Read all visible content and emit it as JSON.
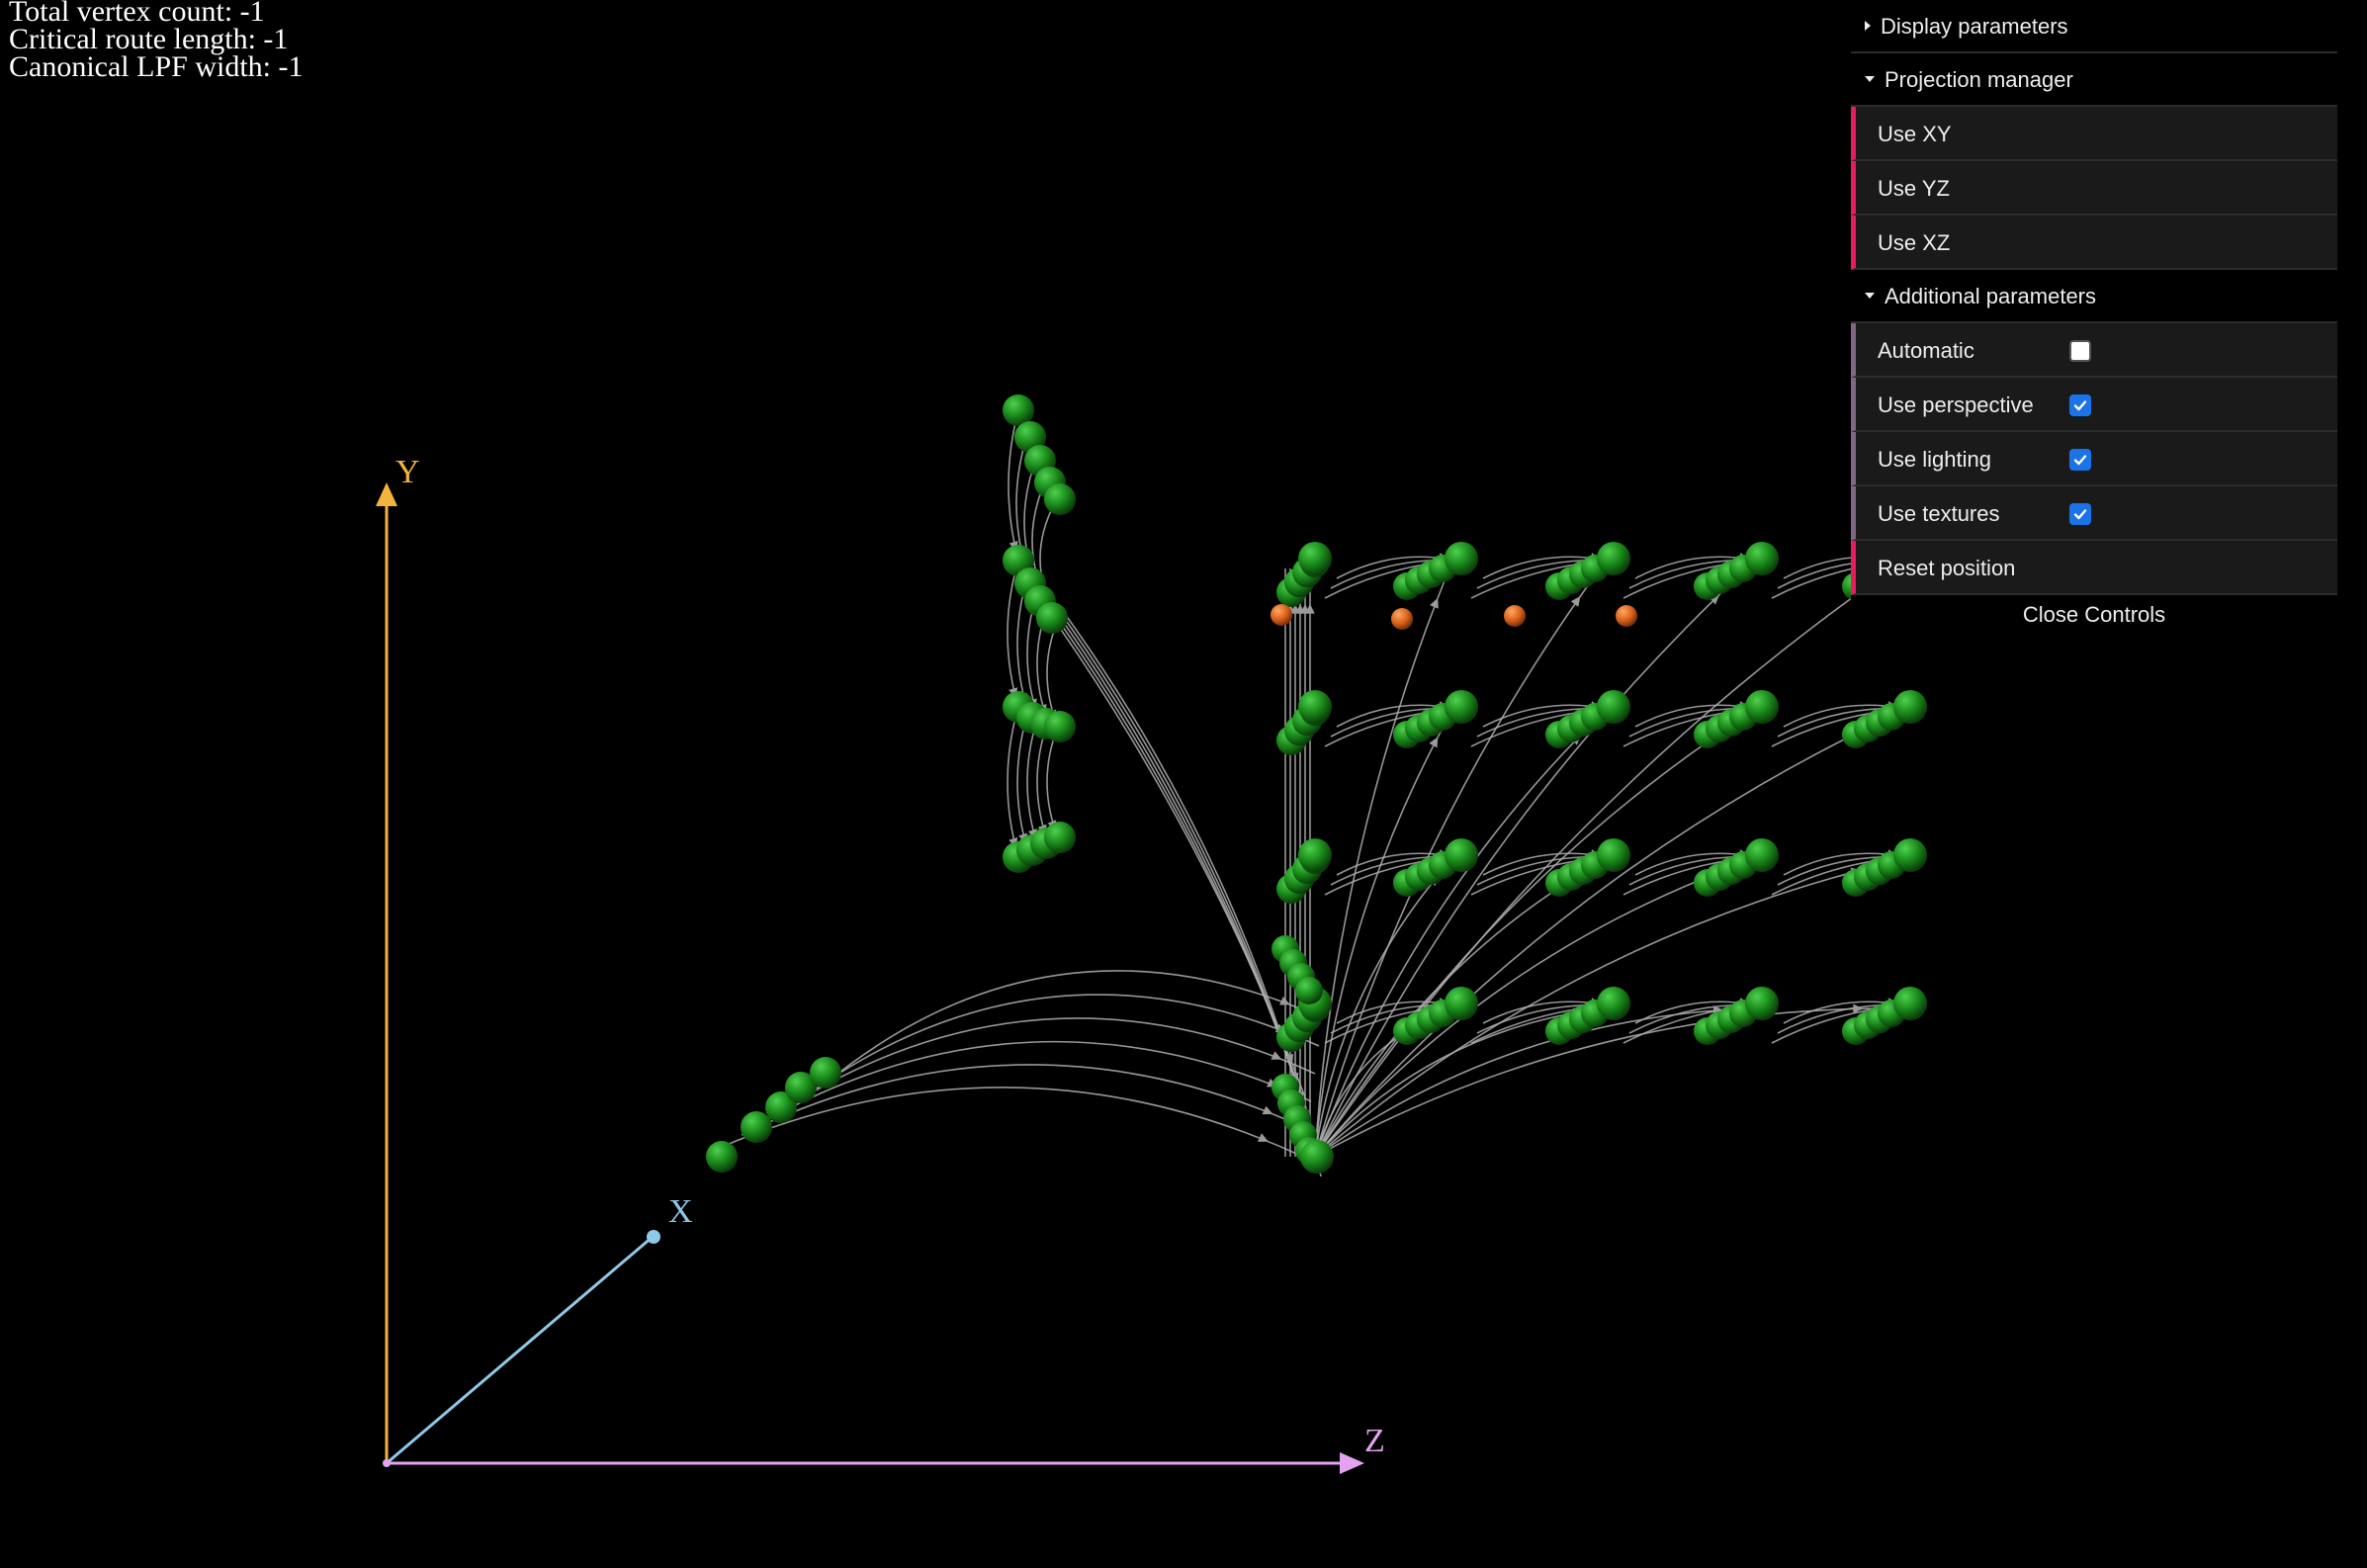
{
  "stats": {
    "vertex_count": "Total vertex count: -1",
    "route_length": "Critical route length: -1",
    "lpf_width": "Canonical LPF width: -1"
  },
  "gui": {
    "display_folder": "Display parameters",
    "projection_folder": "Projection manager",
    "use_xy": "Use XY",
    "use_yz": "Use YZ",
    "use_xz": "Use XZ",
    "additional_folder": "Additional parameters",
    "automatic": {
      "label": "Automatic",
      "checked": false
    },
    "perspective": {
      "label": "Use perspective",
      "checked": true
    },
    "lighting": {
      "label": "Use lighting",
      "checked": true
    },
    "textures": {
      "label": "Use textures",
      "checked": true
    },
    "reset": "Reset position",
    "close": "Close Controls"
  },
  "axes": {
    "x_label": "X",
    "y_label": "Y",
    "z_label": "Z",
    "x_color": "#8ec9e8",
    "y_color": "#f2b43c",
    "z_color": "#e4a3f0"
  },
  "colors": {
    "node_green": "#1f8a1f",
    "node_orange": "#e06a1a",
    "edge": "#b0b0b0"
  }
}
